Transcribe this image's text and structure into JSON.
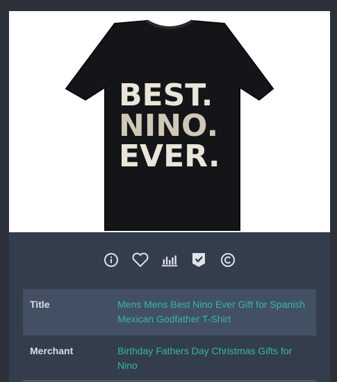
{
  "product": {
    "image_alt": "Black t-shirt with distressed white text BEST. NINO. EVER.",
    "shirt_text": [
      "BEST.",
      "NINO.",
      "EVER."
    ]
  },
  "actions": [
    {
      "name": "info-icon"
    },
    {
      "name": "heart-icon"
    },
    {
      "name": "bar-chart-icon"
    },
    {
      "name": "badge-check-icon"
    },
    {
      "name": "copyright-icon"
    }
  ],
  "details": {
    "title_label": "Title",
    "title_value": "Mens Mens Best Nino Ever Gift for Spanish Mexican Godfather T-Shirt",
    "merchant_label": "Merchant",
    "merchant_value": "Birthday Fathers Day Christmas Gifts for Nino"
  },
  "colors": {
    "background": "#2b303b",
    "panel": "#343d4b",
    "row_shaded": "#435064",
    "accent": "#33b8a5",
    "label_text": "#d9dee5",
    "icon": "#dfe3ea"
  }
}
